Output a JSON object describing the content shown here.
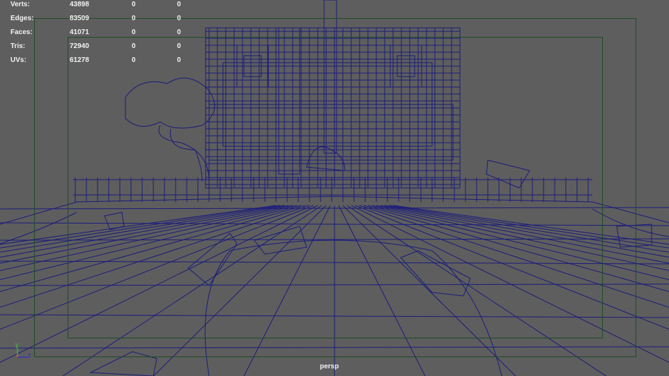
{
  "hud": {
    "rows": [
      {
        "label": "Verts:",
        "values": [
          "43898",
          "0",
          "0"
        ]
      },
      {
        "label": "Edges:",
        "values": [
          "83509",
          "0",
          "0"
        ]
      },
      {
        "label": "Faces:",
        "values": [
          "41071",
          "0",
          "0"
        ]
      },
      {
        "label": "Tris:",
        "values": [
          "72940",
          "0",
          "0"
        ]
      },
      {
        "label": "UVs:",
        "values": [
          "61278",
          "0",
          "0"
        ]
      }
    ]
  },
  "camera_name": "persp",
  "axis": {
    "y": "y",
    "z": "z"
  },
  "colors": {
    "background": "#5e5e5e",
    "wireframe": "#1b1b7d",
    "gate": "#1f4a26",
    "hud_text": "#f2f2f2"
  }
}
